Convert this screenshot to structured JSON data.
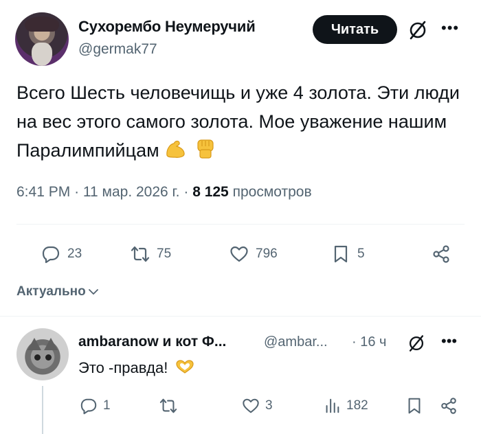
{
  "tweet": {
    "author_name": "Сухорембо Неумеручий",
    "author_handle": "@germak77",
    "follow_label": "Читать",
    "text": "Всего Шесть человечищь и уже 4 золота. Эти люди на вес этого самого золота. Мое уважение нашим Паралимпийцам",
    "emojis": [
      "flexed-biceps",
      "raised-fist"
    ],
    "time": "6:41 PM",
    "date": "11 мар. 2026 г.",
    "views_count": "8 125",
    "views_label": "просмотров",
    "separator": "·",
    "stats": {
      "replies": "23",
      "reposts": "75",
      "likes": "796",
      "bookmarks": "5"
    },
    "icons": [
      "grok-icon",
      "more-icon",
      "reply-icon",
      "repost-icon",
      "like-icon",
      "bookmark-icon",
      "share-icon"
    ]
  },
  "sort": {
    "label": "Актуально"
  },
  "reply": {
    "author_name": "ambaranow и кот Ф...",
    "author_handle": "@ambar...",
    "time": "· 16 ч",
    "text": "Это -правда!",
    "emoji": "heart-hands",
    "stats": {
      "replies": "1",
      "reposts": "",
      "likes": "3",
      "views": "182"
    }
  },
  "colors": {
    "text": "#0f1419",
    "secondary": "#536471",
    "button_bg": "#0f1419",
    "button_text": "#ffffff",
    "divider": "#eff3f4"
  }
}
